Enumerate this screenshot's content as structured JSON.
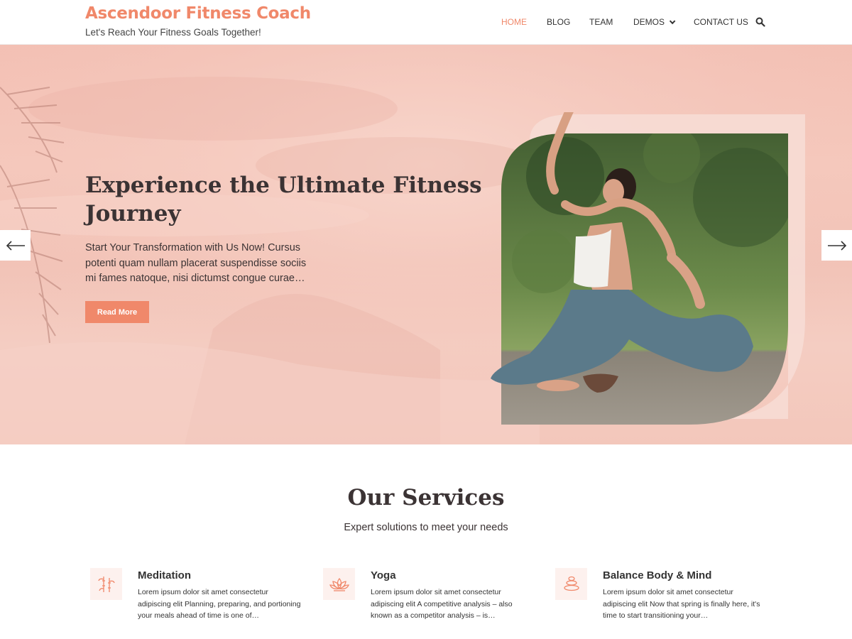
{
  "header": {
    "site_title": "Ascendoor Fitness Coach",
    "tagline": "Let's Reach Your Fitness Goals Together!",
    "nav": [
      {
        "label": "HOME",
        "active": true
      },
      {
        "label": "BLOG",
        "active": false
      },
      {
        "label": "TEAM",
        "active": false
      },
      {
        "label": "DEMOS",
        "active": false,
        "has_dropdown": true
      },
      {
        "label": "CONTACT US",
        "active": false
      }
    ],
    "search_icon": "search-icon"
  },
  "hero": {
    "title": "Experience the Ultimate Fitness Journey",
    "description": "Start Your Transformation with Us Now! Cursus potenti quam nullam placerat suspendisse sociis mi fames natoque, nisi dictumst congue curae…",
    "button_label": "Read More",
    "prev_icon": "arrow-left-icon",
    "next_icon": "arrow-right-icon"
  },
  "services": {
    "title": "Our Services",
    "subtitle": "Expert solutions to meet your needs",
    "items": [
      {
        "name": "Meditation",
        "icon": "bamboo-icon",
        "text": "Lorem ipsum dolor sit amet consectetur adipiscing elit Planning, preparing, and portioning your meals ahead of time is one of…"
      },
      {
        "name": "Yoga",
        "icon": "lotus-icon",
        "text": "Lorem ipsum dolor sit amet consectetur adipiscing elit A competitive analysis – also known as a competitor analysis – is…"
      },
      {
        "name": "Balance Body & Mind",
        "icon": "stones-icon",
        "text": "Lorem ipsum dolor sit amet consectetur adipiscing elit Now that spring is finally here, it's time to start transitioning your…"
      }
    ]
  },
  "colors": {
    "accent": "#f0886a",
    "hero_bg": "#f3c3b7",
    "heading": "#3b3334",
    "icon_bg": "#fdf1ee"
  }
}
